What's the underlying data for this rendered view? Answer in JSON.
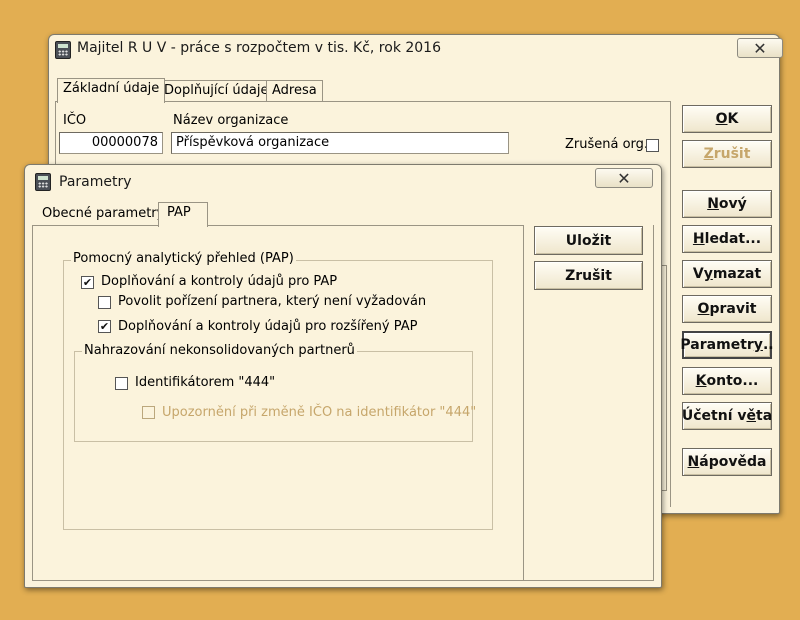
{
  "main_window": {
    "title": "Majitel R U V - práce s rozpočtem v tis. Kč,  rok 2016",
    "close_symbol": "✕",
    "tabs": [
      "Základní údaje",
      "Doplňující údaje",
      "Adresa"
    ],
    "fields": {
      "ico_label": "IČO",
      "ico_value": "00000078",
      "name_label": "Název organizace",
      "name_value": "Příspěvková organizace",
      "cancelled_label": "Zrušená org."
    },
    "buttons": {
      "ok_u": "O",
      "ok_rest": "K",
      "cancel_u": "Z",
      "cancel_rest": "rušit",
      "new_u": "N",
      "new_rest": "ový",
      "search_u": "H",
      "search_rest": "ledat...",
      "delete_pre": "V",
      "delete_u": "y",
      "delete_rest": "mazat",
      "edit_u": "O",
      "edit_rest": "pravit",
      "params_pre": "Parametr",
      "params_u": "y",
      "params_rest": "..",
      "konto_u": "K",
      "konto_rest": "onto...",
      "ucetni_pre": "Účetní v",
      "ucetni_u": "ě",
      "ucetni_rest": "ta",
      "help_u": "N",
      "help_rest": "ápověda"
    }
  },
  "dialog": {
    "title": "Parametry",
    "close_symbol": "✕",
    "tabs": [
      "Obecné parametry",
      "PAP"
    ],
    "group_pap": {
      "label": "Pomocný analytický přehled (PAP)",
      "items": [
        {
          "label": "Doplňování a kontroly údajů pro PAP",
          "checked": true,
          "enabled": true
        },
        {
          "label": "Povolit pořízení partnera, který není vyžadován",
          "checked": false,
          "enabled": true
        },
        {
          "label": "Doplňování a kontroly údajů pro rozšířený PAP",
          "checked": true,
          "enabled": true
        }
      ]
    },
    "group_replace": {
      "label": "Nahrazování  nekonsolidovaných partnerů",
      "items": [
        {
          "label": "Identifikátorem \"444\"",
          "checked": false,
          "enabled": true
        },
        {
          "label": "Upozornění při změně IČO na identifikátor \"444\"",
          "checked": false,
          "enabled": false
        }
      ]
    },
    "buttons": {
      "save": "Uložit",
      "cancel": "Zrušit"
    },
    "check_mark": "✔"
  },
  "colors": {
    "desktop": "#e2ae52",
    "window_bg": "#fbf3dc",
    "disabled_text": "#c6a66b"
  }
}
